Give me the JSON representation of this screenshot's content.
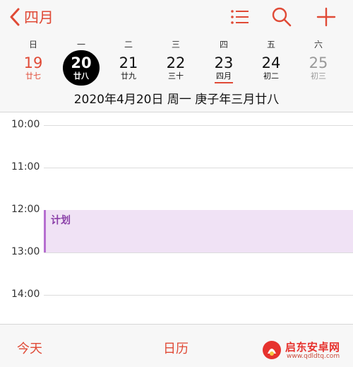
{
  "header": {
    "back_label": "四月",
    "icons": [
      "list-icon",
      "search-icon",
      "add-icon"
    ]
  },
  "week": {
    "weekday_labels": [
      "日",
      "一",
      "二",
      "三",
      "四",
      "五",
      "六"
    ],
    "days": [
      {
        "num": "19",
        "lunar": "廿七"
      },
      {
        "num": "20",
        "lunar": "廿八"
      },
      {
        "num": "21",
        "lunar": "廿九"
      },
      {
        "num": "22",
        "lunar": "三十"
      },
      {
        "num": "23",
        "lunar": "四月"
      },
      {
        "num": "24",
        "lunar": "初二"
      },
      {
        "num": "25",
        "lunar": "初三"
      }
    ],
    "selected_date_line": "2020年4月20日 周一   庚子年三月廿八"
  },
  "timeline": {
    "hours": [
      "10:00",
      "11:00",
      "12:00",
      "13:00",
      "14:00"
    ],
    "event": {
      "title": "计划"
    }
  },
  "bottom": {
    "today_label": "今天",
    "calendar_label": "日历"
  },
  "watermark": {
    "text": "启东安卓网",
    "url": "www.qdldtq.com"
  },
  "colors": {
    "accent": "#e04a36",
    "event_fill": "#f0e2f5",
    "event_border": "#b66fd0"
  }
}
